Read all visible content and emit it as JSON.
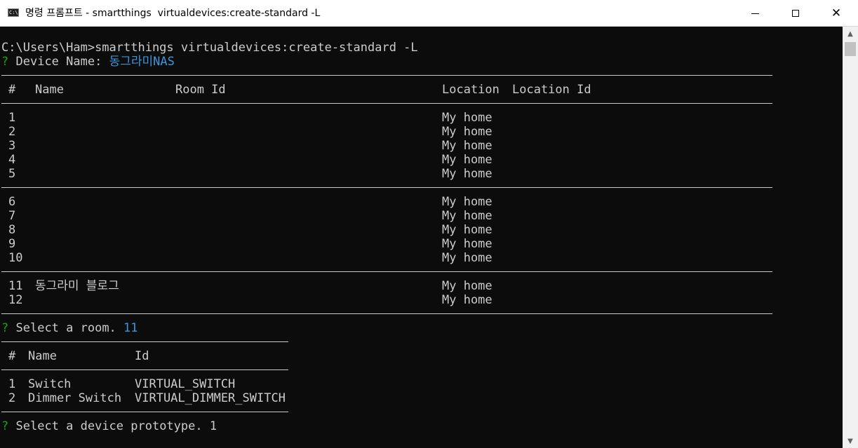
{
  "window": {
    "title": "명령 프롬프트 - smartthings  virtualdevices:create-standard -L",
    "icon_text": "C:\\."
  },
  "console": {
    "prompt_path": "C:\\Users\\Ham>",
    "command": "smartthings virtualdevices:create-standard -L",
    "q_mark": "?",
    "device_name_label": "Device Name:",
    "device_name_value": "동그라미NAS",
    "rooms_table": {
      "headers": [
        "#",
        "Name",
        "Room Id",
        "Location",
        "Location Id"
      ],
      "rows": [
        {
          "num": "1",
          "name": "",
          "location": "My home"
        },
        {
          "num": "2",
          "name": "",
          "location": "My home"
        },
        {
          "num": "3",
          "name": "",
          "location": "My home"
        },
        {
          "num": "4",
          "name": "",
          "location": "My home"
        },
        {
          "num": "5",
          "name": "",
          "location": "My home"
        },
        {
          "num": "6",
          "name": "",
          "location": "My home"
        },
        {
          "num": "7",
          "name": "",
          "location": "My home"
        },
        {
          "num": "8",
          "name": "",
          "location": "My home"
        },
        {
          "num": "9",
          "name": "",
          "location": "My home"
        },
        {
          "num": "10",
          "name": "",
          "location": "My home"
        },
        {
          "num": "11",
          "name": "동그라미 블로그",
          "location": "My home"
        },
        {
          "num": "12",
          "name": "",
          "location": "My home"
        }
      ]
    },
    "select_room_label": "Select a room.",
    "select_room_value": "11",
    "prototype_table": {
      "headers": [
        "#",
        "Name",
        "Id"
      ],
      "rows": [
        {
          "num": "1",
          "name": "Switch",
          "id": "VIRTUAL_SWITCH"
        },
        {
          "num": "2",
          "name": "Dimmer Switch",
          "id": "VIRTUAL_DIMMER_SWITCH"
        }
      ]
    },
    "select_prototype_label": "Select a device prototype.",
    "select_prototype_value": "1"
  },
  "colors": {
    "background": "#0c0c0c",
    "text": "#cccccc",
    "prompt_green": "#13a10e",
    "answer_blue": "#3a96dd"
  },
  "icons": [
    "console-app-icon",
    "minimize-icon",
    "maximize-icon",
    "close-icon",
    "scroll-up-icon",
    "scroll-down-icon"
  ]
}
